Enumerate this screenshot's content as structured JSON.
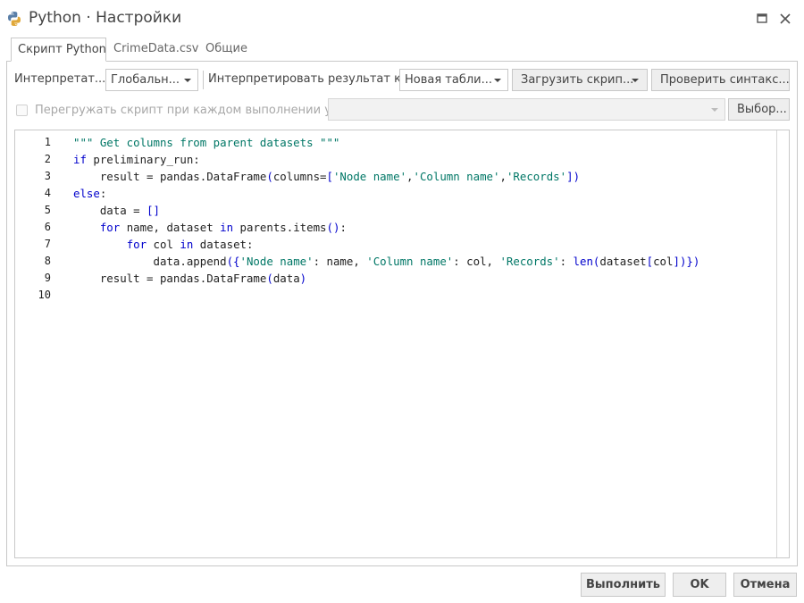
{
  "window": {
    "title": "Python · Настройки",
    "icons": {
      "app": "python-icon",
      "maximize": "maximize-icon",
      "close": "close-icon"
    }
  },
  "tabs": [
    {
      "label": "Скрипт Python",
      "active": true
    },
    {
      "label": "CrimeData.csv",
      "active": false
    },
    {
      "label": "Общие",
      "active": false
    }
  ],
  "toolbar": {
    "interpreter_label": "Интерпретат...",
    "interpreter_value": "Глобальн...",
    "interpret_result_label": "Интерпретировать результат к...",
    "result_target_value": "Новая табли...",
    "load_script_label": "Загрузить скрип...",
    "check_syntax_label": "Проверить синтакс..."
  },
  "reload_row": {
    "checkbox_label": "Перегружать скрипт при каждом выполнении узла",
    "checked": false,
    "path_value": "",
    "browse_label": "Выбор..."
  },
  "editor": {
    "line_numbers": [
      "1",
      "2",
      "3",
      "4",
      "5",
      "6",
      "7",
      "8",
      "9",
      "10"
    ],
    "lines": [
      "\"\"\" Get columns from parent datasets \"\"\"",
      "if preliminary_run:",
      "    result = pandas.DataFrame(columns=['Node name','Column name','Records'])",
      "else:",
      "    data = []",
      "    for name, dataset in parents.items():",
      "        for col in dataset:",
      "            data.append({'Node name': name, 'Column name': col, 'Records': len(dataset[col])})",
      "    result = pandas.DataFrame(data)",
      ""
    ]
  },
  "footer": {
    "run_label": "Выполнить",
    "ok_label": "OK",
    "cancel_label": "Отмена"
  },
  "colors": {
    "keyword": "#0000cc",
    "string": "#007766",
    "border": "#c8c8c8",
    "button_bg": "#eeeeee"
  }
}
